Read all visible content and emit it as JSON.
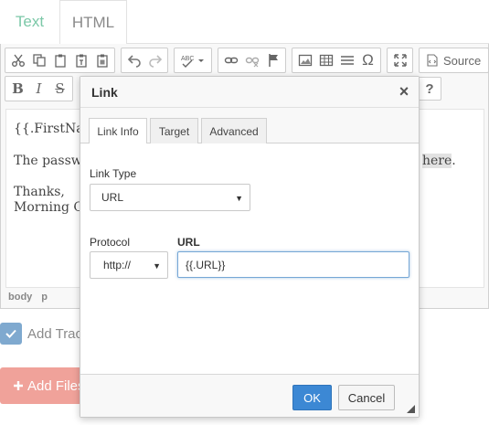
{
  "mode_tabs": {
    "text": "Text",
    "html": "HTML"
  },
  "toolbar": {
    "source_label": "Source",
    "format_bold": "B",
    "format_italic": "I",
    "format_strike": "S",
    "help": "?"
  },
  "content": {
    "line1": "{{.FirstNam",
    "line2": "The passwo",
    "line2_link": "here",
    "line2_end": ".",
    "line3": "Thanks,",
    "line4": "Morning Ca"
  },
  "path_bar": [
    "body",
    "p"
  ],
  "checkbox_label": "Add Track",
  "add_files_label": "Add Files",
  "dialog": {
    "title": "Link",
    "close": "×",
    "tabs": [
      "Link Info",
      "Target",
      "Advanced"
    ],
    "link_type_label": "Link Type",
    "link_type_value": "URL",
    "protocol_label": "Protocol",
    "protocol_value": "http://",
    "url_label": "URL",
    "url_value": "{{.URL}}",
    "ok_label": "OK",
    "cancel_label": "Cancel"
  },
  "colors": {
    "ok_button": "#3c88d4",
    "text_tab": "#7cc8a8",
    "add_files": "#f0a29a",
    "checkbox": "#7fa9cf"
  }
}
